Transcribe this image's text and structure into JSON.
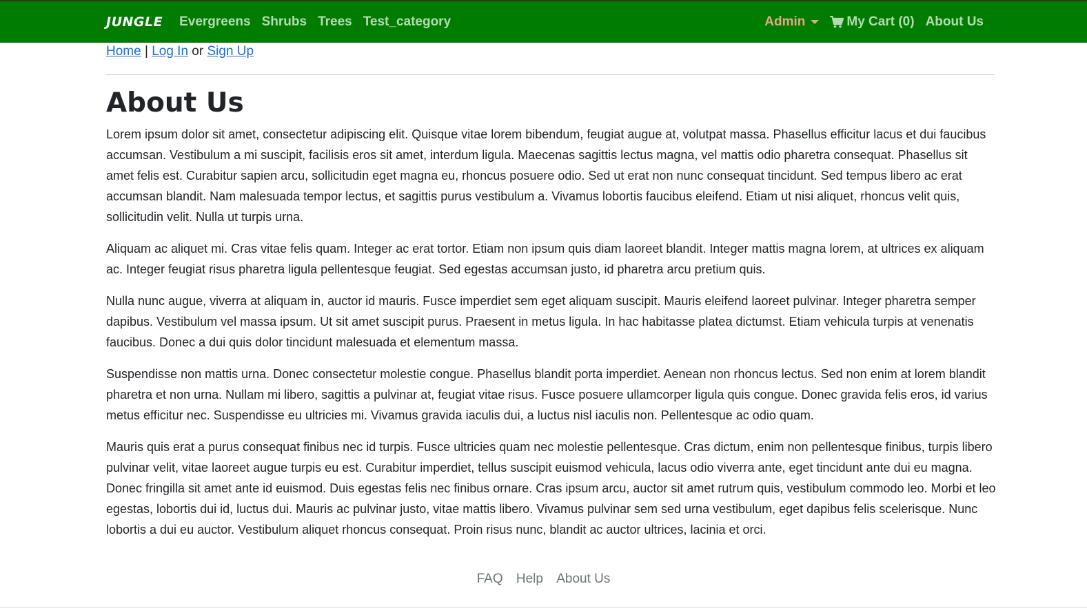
{
  "navbar": {
    "brand": "JUNGLE",
    "categories": [
      "Evergreens",
      "Shrubs",
      "Trees",
      "Test_category"
    ],
    "admin_label": "Admin",
    "cart_label": "My Cart (0)",
    "about_label": "About Us",
    "icons": {
      "cart": "shopping-cart-icon",
      "caret": "caret-down-icon"
    },
    "colors": {
      "background": "#007d00",
      "link": "#b7d8b3",
      "admin": "#e6a58a"
    }
  },
  "breadcrumb": {
    "home": "Home",
    "sep": "|",
    "login": "Log In",
    "or": "or",
    "signup": "Sign Up"
  },
  "page": {
    "title": "About Us",
    "paragraphs": [
      "Lorem ipsum dolor sit amet, consectetur adipiscing elit. Quisque vitae lorem bibendum, feugiat augue at, volutpat massa. Phasellus efficitur lacus et dui faucibus accumsan. Vestibulum a mi suscipit, facilisis eros sit amet, interdum ligula. Maecenas sagittis lectus magna, vel mattis odio pharetra consequat. Phasellus sit amet felis est. Curabitur sapien arcu, sollicitudin eget magna eu, rhoncus posuere odio. Sed ut erat non nunc consequat tincidunt. Sed tempus libero ac erat accumsan blandit. Nam malesuada tempor lectus, et sagittis purus vestibulum a. Vivamus lobortis faucibus eleifend. Etiam ut nisi aliquet, rhoncus velit quis, sollicitudin velit. Nulla ut turpis urna.",
      "Aliquam ac aliquet mi. Cras vitae felis quam. Integer ac erat tortor. Etiam non ipsum quis diam laoreet blandit. Integer mattis magna lorem, at ultrices ex aliquam ac. Integer feugiat risus pharetra ligula pellentesque feugiat. Sed egestas accumsan justo, id pharetra arcu pretium quis.",
      "Nulla nunc augue, viverra at aliquam in, auctor id mauris. Fusce imperdiet sem eget aliquam suscipit. Mauris eleifend laoreet pulvinar. Integer pharetra semper dapibus. Vestibulum vel massa ipsum. Ut sit amet suscipit purus. Praesent in metus ligula. In hac habitasse platea dictumst. Etiam vehicula turpis at venenatis faucibus. Donec a dui quis dolor tincidunt malesuada et elementum massa.",
      "Suspendisse non mattis urna. Donec consectetur molestie congue. Phasellus blandit porta imperdiet. Aenean non rhoncus lectus. Sed non enim at lorem blandit pharetra et non urna. Nullam mi libero, sagittis a pulvinar at, feugiat vitae risus. Fusce posuere ullamcorper ligula quis congue. Donec gravida felis eros, id varius metus efficitur nec. Suspendisse eu ultricies mi. Vivamus gravida iaculis dui, a luctus nisl iaculis non. Pellentesque ac odio quam.",
      "Mauris quis erat a purus consequat finibus nec id turpis. Fusce ultricies quam nec molestie pellentesque. Cras dictum, enim non pellentesque finibus, turpis libero pulvinar velit, vitae laoreet augue turpis eu est. Curabitur imperdiet, tellus suscipit euismod vehicula, lacus odio viverra ante, eget tincidunt ante dui eu magna. Donec fringilla sit amet ante id euismod. Duis egestas felis nec finibus ornare. Cras ipsum arcu, auctor sit amet rutrum quis, vestibulum commodo leo. Morbi et leo egestas, lobortis dui id, luctus dui. Mauris ac pulvinar justo, vitae mattis libero. Vivamus pulvinar sem sed urna vestibulum, eget dapibus felis scelerisque. Nunc lobortis a dui eu auctor. Vestibulum aliquet rhoncus consequat. Proin risus nunc, blandit ac auctor ultrices, lacinia et orci."
    ]
  },
  "footer": {
    "links": [
      "FAQ",
      "Help",
      "About Us"
    ]
  }
}
